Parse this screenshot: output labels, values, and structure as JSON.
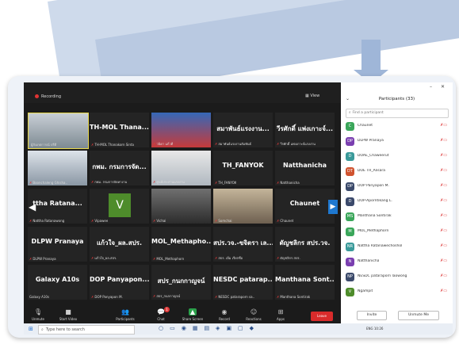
{
  "topbar": {
    "recording": "Recording",
    "view": "View"
  },
  "tiles": [
    {
      "name": "",
      "label": "ผู้สังเกตการณ์ ปรีดี"
    },
    {
      "name": "TH-MOL  Thana...",
      "label": "TH-MOL Thanakorn Sinta"
    },
    {
      "name": "",
      "label": "วนิดา แก้วดี"
    },
    {
      "name": "สมาพันธ์แรงงาน...",
      "label": "สมาพันธ์แรงงานสัมพันธ์"
    },
    {
      "name": "วีรศักดิ์ แพ่งเกาะจ์...",
      "label": "วีรศักดิ์ แพ่งเกาะจ์แรงงาน"
    },
    {
      "name": "",
      "label": "Boonchaleng Ghisha.."
    },
    {
      "name": "กพม. กรมการจัด...",
      "label": "กพม. กรมการจัดหางาน"
    },
    {
      "name": "",
      "label": "ศูนย์ประสานแรงงาน"
    },
    {
      "name": "TH_FANYOK",
      "label": "TH_FANYOK"
    },
    {
      "name": "Natthanicha",
      "label": "Natthanicha"
    },
    {
      "name": "ttha  Ratana...",
      "label": "Nattha Ratanawong"
    },
    {
      "name": "V",
      "label": "Vipawee"
    },
    {
      "name": "",
      "label": "Vichai"
    },
    {
      "name": "",
      "label": "Somchai"
    },
    {
      "name": "Chaunet",
      "label": "Chaunet"
    },
    {
      "name": "DLPW Pranaya",
      "label": "DLPW Pranaya"
    },
    {
      "name": "แก้วใจ_ผล.สปร.",
      "label": "แก้วใจ_ผล.สปร."
    },
    {
      "name": "MOL_Methapho...",
      "label": "MOL_Methaphorn"
    },
    {
      "name": "สปร.วจ.-ขจิตรา เล...",
      "label": "สปร. เอิ่ม เรียกชื่อ"
    },
    {
      "name": "ดัญชลิกร สปร.วจ.",
      "label": "ดัญชลิกร สปร."
    },
    {
      "name": "Galaxy A10s",
      "label": "Galaxy A10s"
    },
    {
      "name": "DOP  Panyapon...",
      "label": "DOP Panyapon M."
    },
    {
      "name": "สปร_กนกกาญจน์",
      "label": "สปร_กนกกาญจน์"
    },
    {
      "name": "NESDC  patarap...",
      "label": "NESDC pataraporn sa.."
    },
    {
      "name": "Manthana  Sont...",
      "label": "Manthana Sontirak"
    }
  ],
  "toolbar": {
    "unmute": "Unmute",
    "start_video": "Start Video",
    "participants": "Participants",
    "participants_count": "33",
    "chat": "Chat",
    "chat_badge": "1",
    "share": "Share Screen",
    "record": "Record",
    "reactions": "Reactions",
    "apps": "Apps",
    "leave": "Leave"
  },
  "panel": {
    "title": "Participants (33)",
    "search_placeholder": "Find a participant",
    "invite": "Invite",
    "unmute_me": "Unmute Me",
    "participants": [
      {
        "initial": "C",
        "name": "Chaunet",
        "color": "#3aa65a"
      },
      {
        "initial": "DP",
        "name": "DLPW Pranaya",
        "color": "#7a3fb0"
      },
      {
        "initial": "D",
        "name": "DOAE_Chaweerut",
        "color": "#3a9a9a"
      },
      {
        "initial": "DT",
        "name": "DOE TH_Alisara",
        "color": "#d0532f"
      },
      {
        "initial": "DP",
        "name": "DOP Panyapon M.",
        "color": "#3b4a6b"
      },
      {
        "initial": "D",
        "name": "DOP-Aporntikang L.",
        "color": "#3b4a6b"
      },
      {
        "initial": "MS",
        "name": "Manthana Sontirak",
        "color": "#3aa65a"
      },
      {
        "initial": "M",
        "name": "MOL_Methaphorn",
        "color": "#3aa65a"
      },
      {
        "initial": "NR",
        "name": "Nattha Ratanawechoshol",
        "color": "#3a9a9a"
      },
      {
        "initial": "N",
        "name": "Natthanicha",
        "color": "#7a3fb0"
      },
      {
        "initial": "NP",
        "name": "NESDC pataraporn laowong",
        "color": "#3b4a6b"
      },
      {
        "initial": "V",
        "name": "Ngampit",
        "color": "#4e8c2b"
      }
    ]
  },
  "taskbar": {
    "search": "Type here to search",
    "tray": "ENG  10:26"
  }
}
